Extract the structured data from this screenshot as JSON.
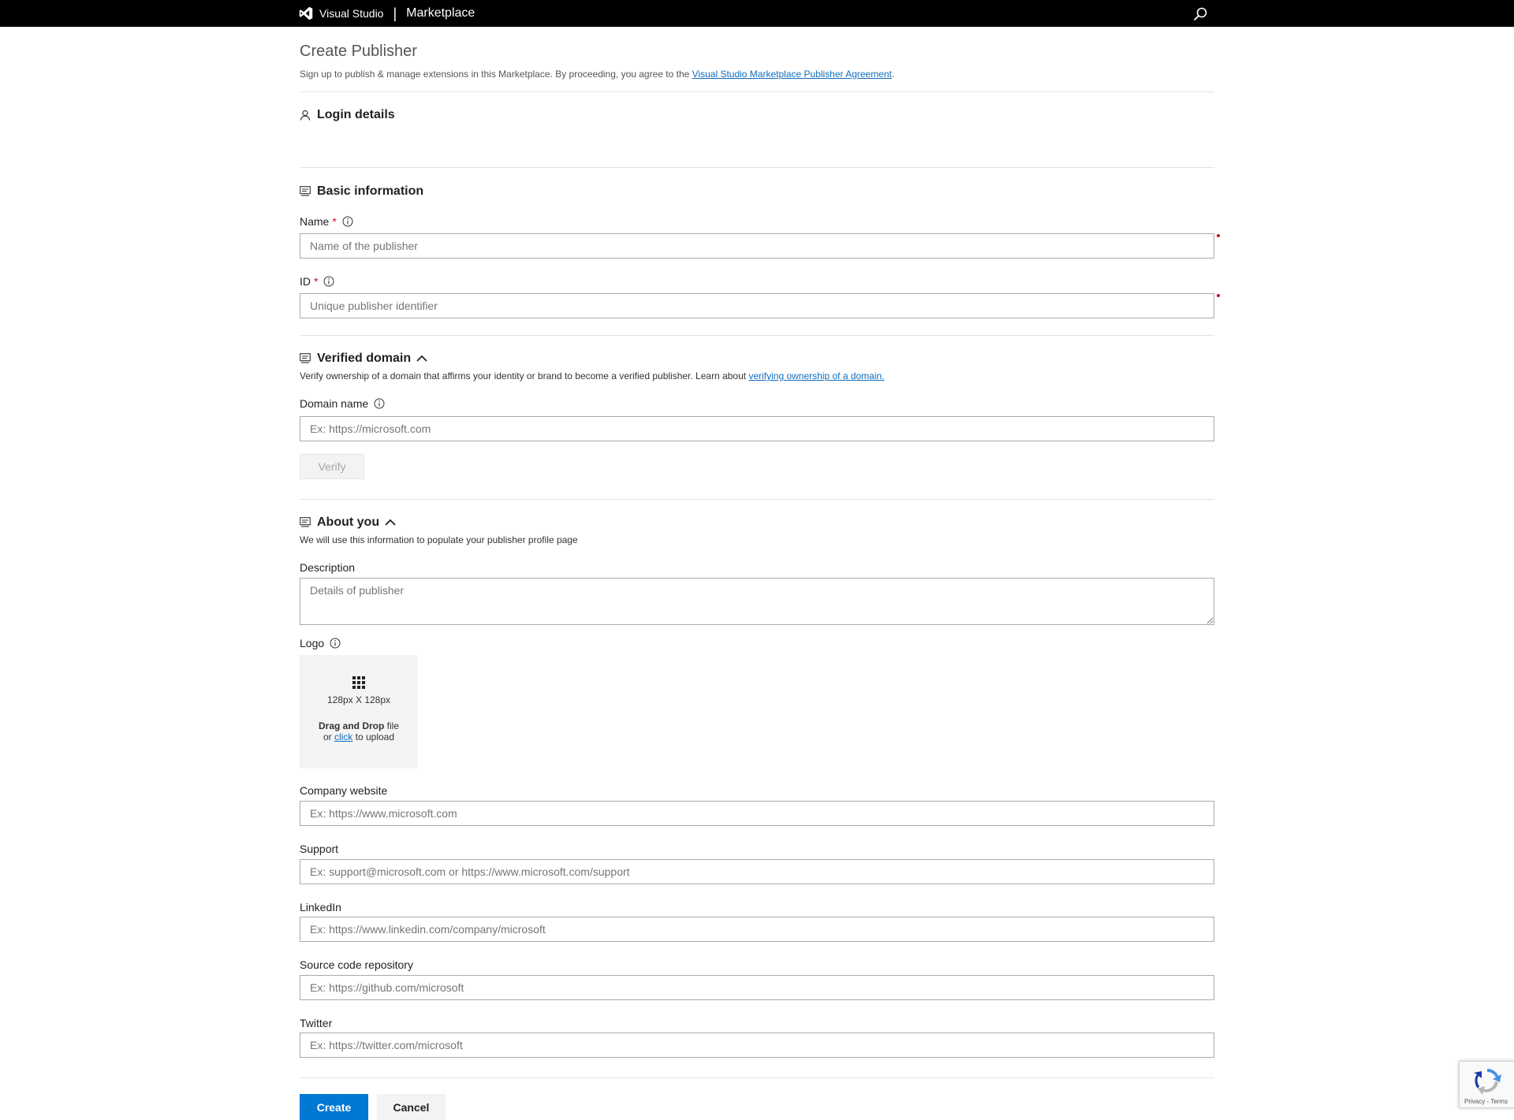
{
  "header": {
    "brand": "Visual Studio",
    "separator": "|",
    "product": "Marketplace",
    "search_icon": "search-icon",
    "logo_icon": "visual-studio-logo"
  },
  "page": {
    "title": "Create Publisher",
    "intro_text": "Sign up to publish & manage extensions in this Marketplace. By proceeding, you agree to the ",
    "agreement_link": "Visual Studio Marketplace Publisher Agreement",
    "intro_end": "."
  },
  "login": {
    "title": "Login details",
    "icon": "person-icon"
  },
  "basic": {
    "title": "Basic information",
    "icon": "form-icon",
    "name_label": "Name",
    "name_placeholder": "Name of the publisher",
    "id_label": "ID",
    "id_placeholder": "Unique publisher identifier",
    "required_mark": "*"
  },
  "domain": {
    "title": "Verified domain",
    "desc_text": "Verify ownership of a domain that affirms your identity or brand to become a verified publisher. Learn about ",
    "desc_link": "verifying ownership of a domain.",
    "domain_label": "Domain name",
    "domain_placeholder": "Ex: https://microsoft.com",
    "verify_label": "Verify"
  },
  "about": {
    "title": "About you",
    "desc": "We will use this information to populate your publisher profile page",
    "description_label": "Description",
    "description_placeholder": "Details of publisher",
    "logo_label": "Logo",
    "logo_size": "128px X 128px",
    "logo_drag_bold": "Drag and Drop",
    "logo_drag_rest": " file",
    "logo_or": "or ",
    "logo_click": "click",
    "logo_upload": " to upload",
    "website_label": "Company website",
    "website_placeholder": "Ex: https://www.microsoft.com",
    "support_label": "Support",
    "support_placeholder": "Ex: support@microsoft.com or https://www.microsoft.com/support",
    "linkedin_label": "LinkedIn",
    "linkedin_placeholder": "Ex: https://www.linkedin.com/company/microsoft",
    "repo_label": "Source code repository",
    "repo_placeholder": "Ex: https://github.com/microsoft",
    "twitter_label": "Twitter",
    "twitter_placeholder": "Ex: https://twitter.com/microsoft"
  },
  "actions": {
    "create": "Create",
    "cancel": "Cancel"
  },
  "recaptcha": {
    "text": "Privacy - Terms",
    "icon": "recaptcha-icon"
  },
  "colors": {
    "primary": "#0078d4",
    "link": "#106ebe",
    "required": "#c50f1f",
    "topbar": "#000000"
  }
}
